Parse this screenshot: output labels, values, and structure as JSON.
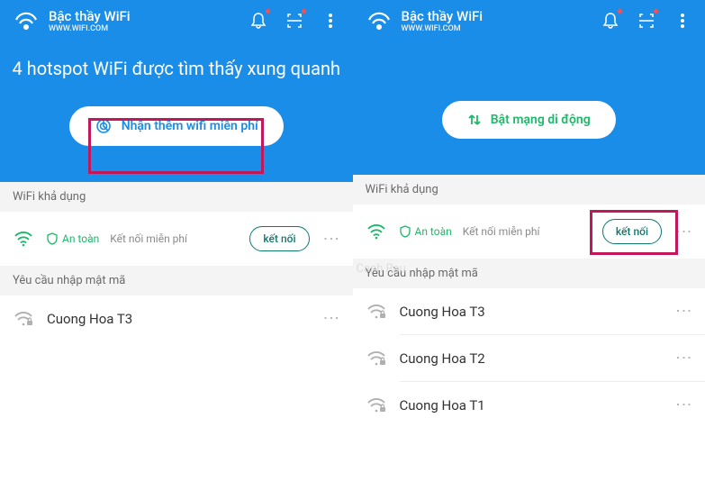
{
  "app": {
    "title": "Bậc thầy WiFi",
    "subtitle": "WWW.WIFI.COM"
  },
  "left": {
    "hero": "4 hotspot WiFi được tìm thấy xung quanh",
    "cta": "Nhận thêm wifi miễn phí",
    "available": "WiFi khả dụng",
    "safe": "An toàn",
    "free": "Kết nối miễn phí",
    "connect": "kết nối",
    "password_required": "Yêu cầu nhập mật mã",
    "networks": [
      {
        "name": "Cuong Hoa T3"
      }
    ]
  },
  "right": {
    "cta": "Bật mạng di động",
    "available": "WiFi khả dụng",
    "safe": "An toàn",
    "free": "Kết nối miễn phí",
    "connect": "kết nối",
    "password_required": "Yêu cầu nhập mật mã",
    "watermark": "Canh Rau",
    "networks": [
      {
        "name": "Cuong Hoa T3"
      },
      {
        "name": "Cuong Hoa T2"
      },
      {
        "name": "Cuong Hoa T1"
      }
    ]
  }
}
